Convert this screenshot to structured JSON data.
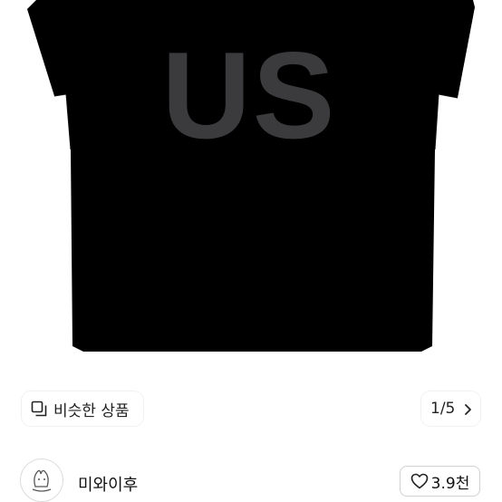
{
  "product": {
    "shirt_print": "US",
    "shirt_color": "#000000",
    "print_color": "#3b3b3d"
  },
  "overlay": {
    "similar_label": "비슷한 상품",
    "pager_text": "1/5"
  },
  "seller": {
    "name": "미와이후",
    "like_count": "3.9천"
  },
  "icons": {
    "similar": "similar-items-icon",
    "next": "chevron-right-icon",
    "like": "heart-icon",
    "avatar": "shop-avatar"
  }
}
